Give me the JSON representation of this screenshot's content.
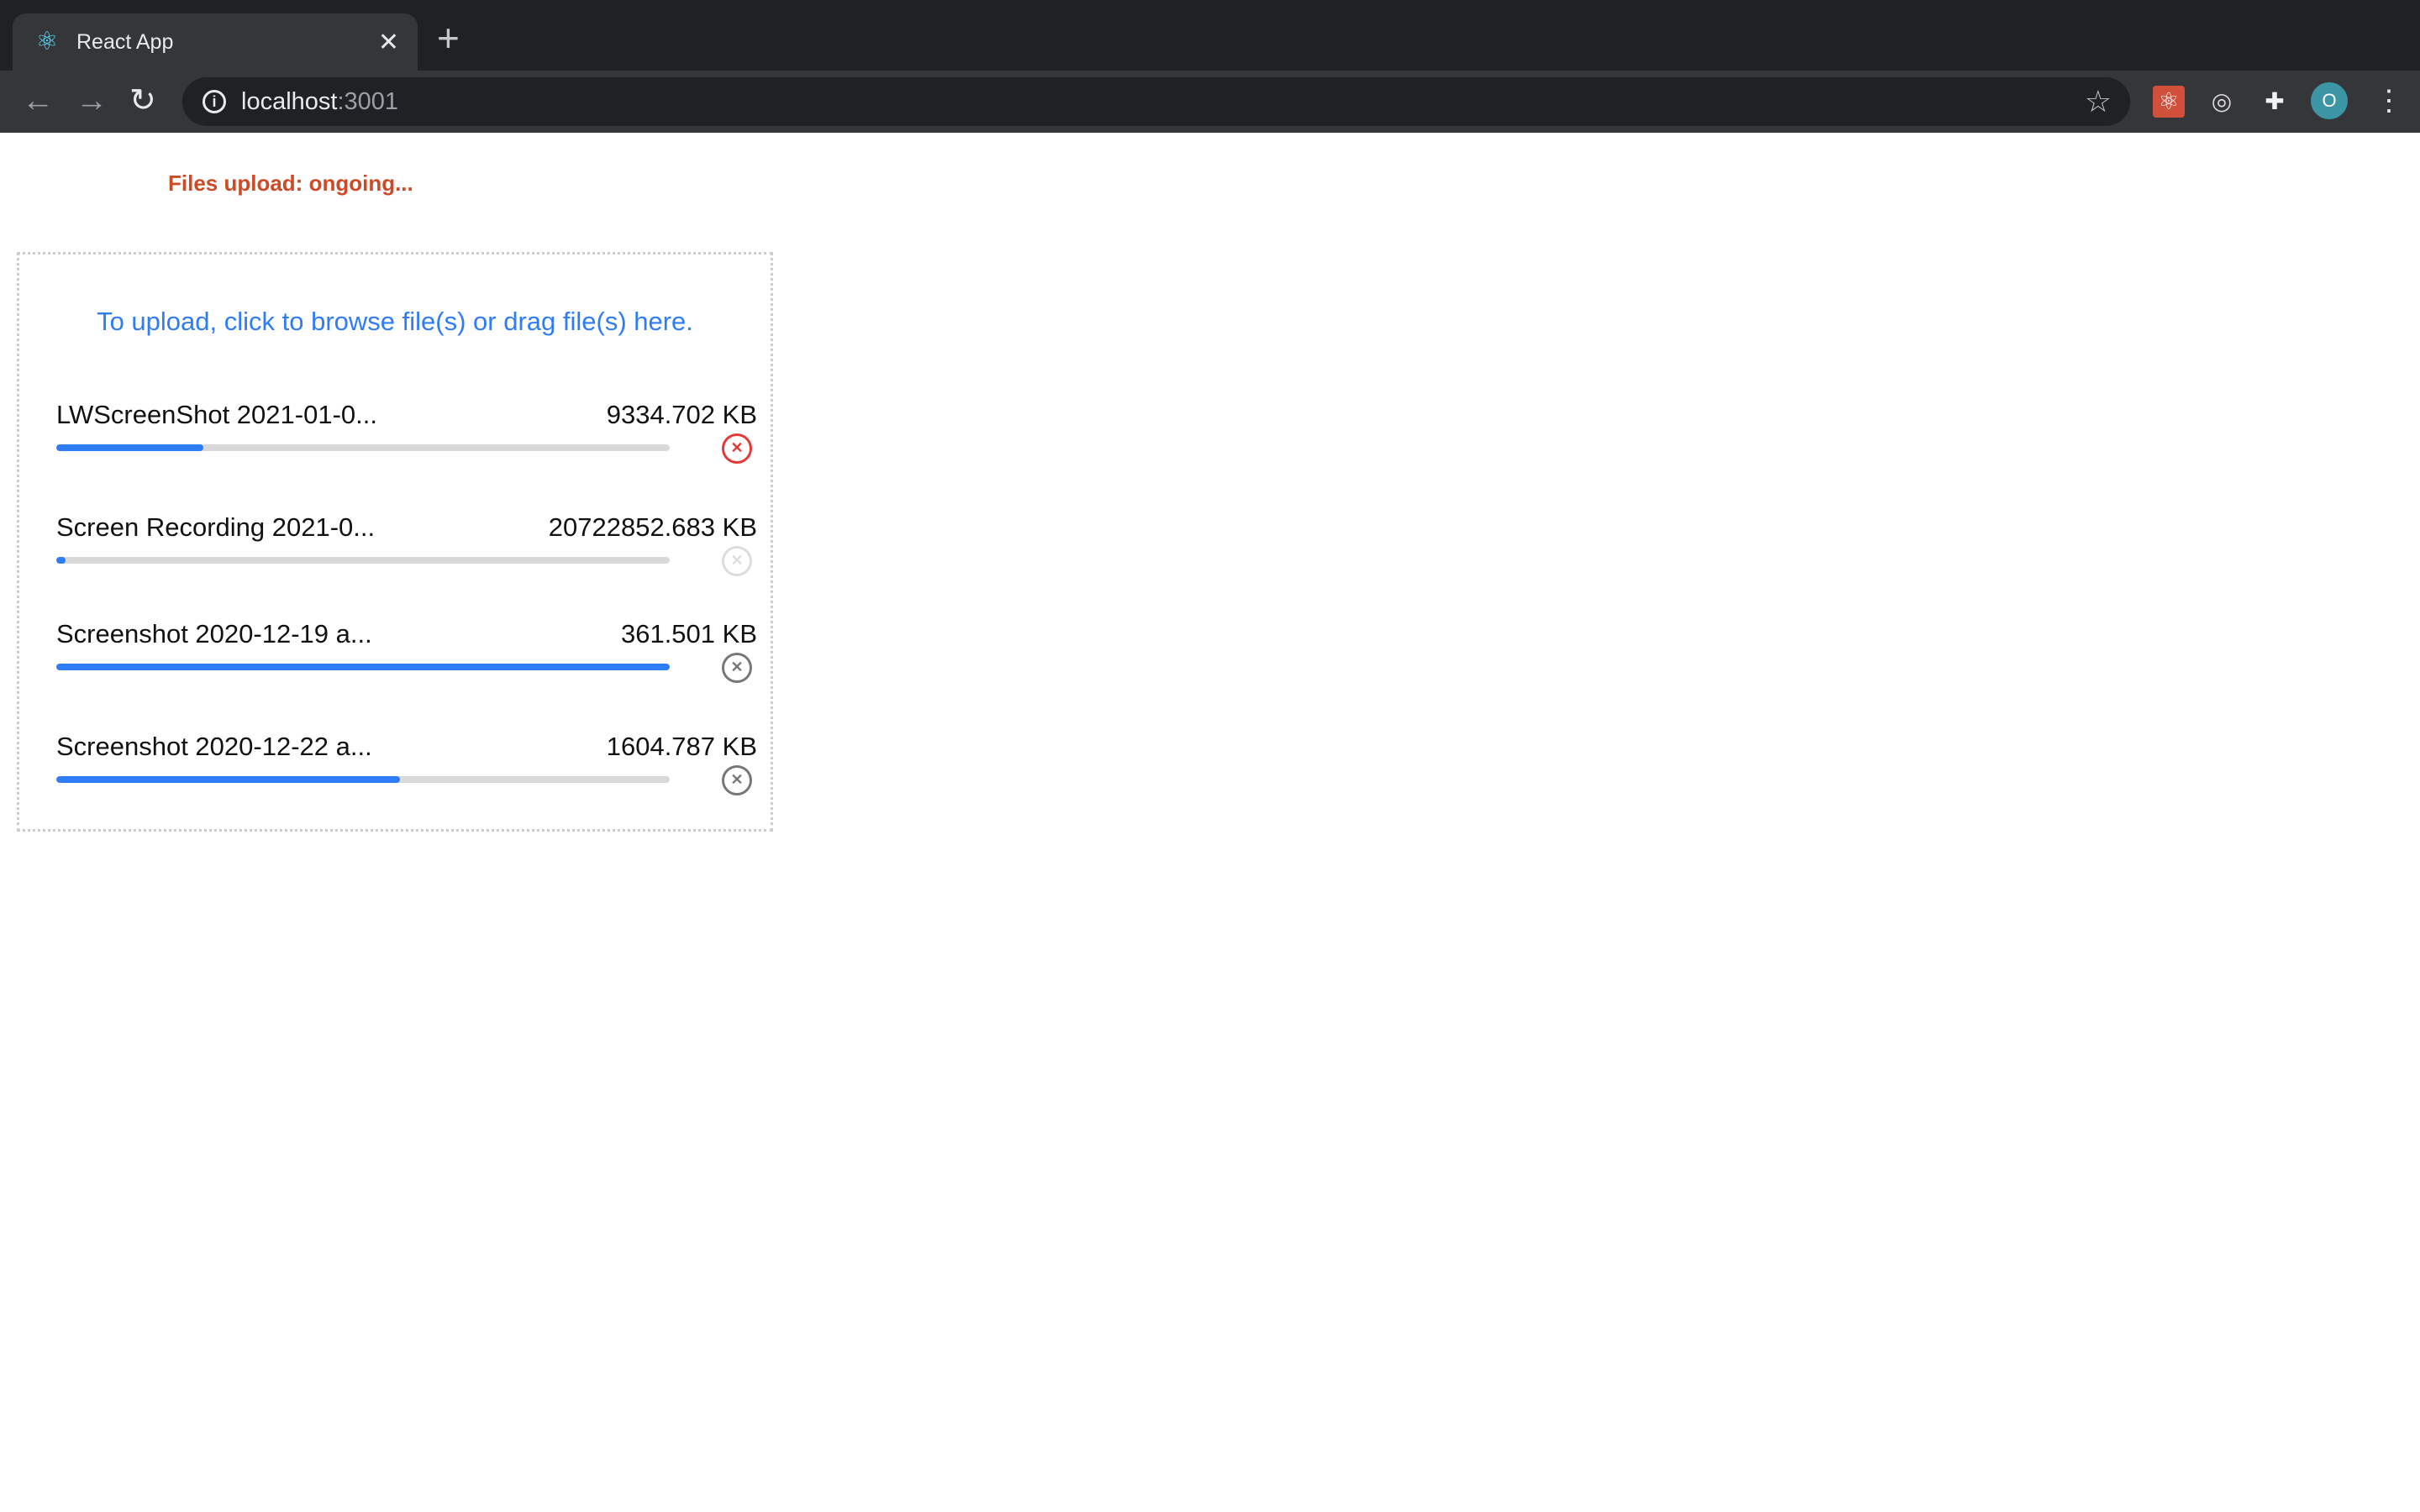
{
  "browser": {
    "tab_title": "React App",
    "tab_icon": "react-logo-icon",
    "new_tab": "+",
    "close": "✕",
    "url_host": "localhost",
    "url_port": ":3001",
    "avatar_letter": "O"
  },
  "page": {
    "status": "Files upload: ongoing...",
    "hint": "To upload, click to browse file(s) or drag file(s) here.",
    "accent": "#2e7cf6",
    "status_color": "#cc4a26",
    "files": [
      {
        "name": "LWScreenShot 2021-01-0...",
        "size": "9334.702 KB",
        "progress": 24,
        "cancel_state": "active"
      },
      {
        "name": "Screen Recording 2021-0...",
        "size": "20722852.683 KB",
        "progress": 1.5,
        "cancel_state": "disabled"
      },
      {
        "name": "Screenshot 2020-12-19 a...",
        "size": "361.501 KB",
        "progress": 100,
        "cancel_state": "normal"
      },
      {
        "name": "Screenshot 2020-12-22 a...",
        "size": "1604.787 KB",
        "progress": 56,
        "cancel_state": "normal"
      }
    ]
  }
}
